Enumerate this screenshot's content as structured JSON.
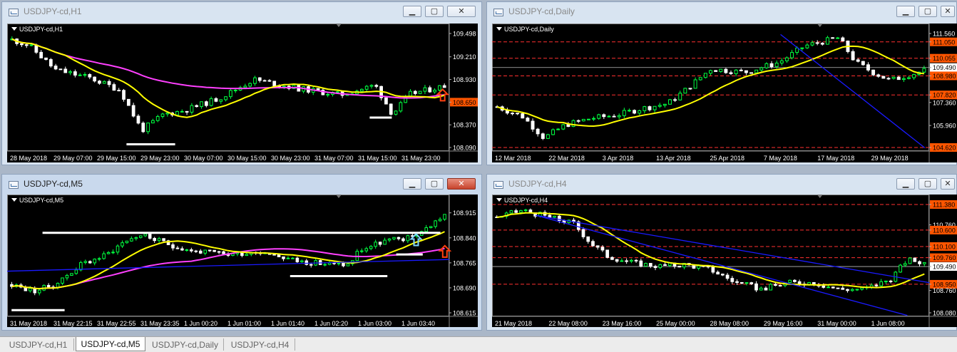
{
  "colors": {
    "bull": "#00ff40",
    "bear": "#ffffff",
    "ma": "#ffff00",
    "ma_slow": "#ff40ff",
    "level": "#ff3030",
    "trend": "#1a1aff",
    "label_bg": "#ff5500"
  },
  "icons": {
    "menu": "triangle-down-icon",
    "window": "chart-window-icon",
    "minimize": "minimize-icon",
    "restore": "restore-icon",
    "close": "close-icon"
  },
  "windows": {
    "h1": {
      "title": "USDJPY-cd,H1",
      "symbol": "USDJPY-cd,H1",
      "prices": [
        "109.498",
        "109.210",
        "108.930",
        "108.650",
        "108.370",
        "108.090"
      ],
      "current_price": "108.650",
      "times": [
        "28 May 2018",
        "29 May 07:00",
        "29 May 15:00",
        "29 May 23:00",
        "30 May 07:00",
        "30 May 15:00",
        "30 May 23:00",
        "31 May 07:00",
        "31 May 15:00",
        "31 May 23:00"
      ]
    },
    "daily": {
      "title": "USDJPY-cd,Daily",
      "symbol": "USDJPY-cd,Daily",
      "prices": [
        "111.560",
        "111.050",
        "110.055",
        "109.490",
        "108.980",
        "107.820",
        "107.360",
        "105.960",
        "104.620"
      ],
      "highlight_price": "109.490",
      "times": [
        "12 Mar 2018",
        "22 Mar 2018",
        "3 Apr 2018",
        "13 Apr 2018",
        "25 Apr 2018",
        "7 May 2018",
        "17 May 2018",
        "29 May 2018"
      ]
    },
    "m5": {
      "title": "USDJPY-cd,M5",
      "symbol": "USDJPY-cd,M5",
      "prices": [
        "108.915",
        "108.840",
        "108.765",
        "108.690",
        "108.615"
      ],
      "times": [
        "31 May 2018",
        "31 May 22:15",
        "31 May 22:55",
        "31 May 23:35",
        "1 Jun 00:20",
        "1 Jun 01:00",
        "1 Jun 01:40",
        "1 Jun 02:20",
        "1 Jun 03:00",
        "1 Jun 03:40"
      ]
    },
    "h4": {
      "title": "USDJPY-cd,H4",
      "symbol": "USDJPY-cd,H4",
      "prices": [
        "111.380",
        "110.760",
        "110.600",
        "110.100",
        "109.760",
        "109.490",
        "108.950",
        "108.760",
        "108.080"
      ],
      "highlight_price": "109.490",
      "times": [
        "21 May 2018",
        "22 May 08:00",
        "23 May 16:00",
        "25 May 00:00",
        "28 May 08:00",
        "29 May 16:00",
        "31 May 00:00",
        "1 Jun 08:00"
      ]
    }
  },
  "chart_data": [
    {
      "type": "candlestick",
      "name": "USDJPY-cd,H1",
      "x_labels": [
        "28 May 2018",
        "29 May 07:00",
        "29 May 15:00",
        "29 May 23:00",
        "30 May 07:00",
        "30 May 15:00",
        "30 May 23:00",
        "31 May 07:00",
        "31 May 15:00",
        "31 May 23:00"
      ],
      "ylim": [
        108.09,
        109.498
      ],
      "y_ticks": [
        109.498,
        109.21,
        108.93,
        108.65,
        108.37,
        108.09
      ],
      "anchors": [
        [
          0,
          109.42
        ],
        [
          0.04,
          109.35
        ],
        [
          0.1,
          109.05
        ],
        [
          0.18,
          108.95
        ],
        [
          0.25,
          108.8
        ],
        [
          0.3,
          108.3
        ],
        [
          0.35,
          108.5
        ],
        [
          0.4,
          108.55
        ],
        [
          0.48,
          108.7
        ],
        [
          0.56,
          108.93
        ],
        [
          0.66,
          108.82
        ],
        [
          0.76,
          108.74
        ],
        [
          0.84,
          108.86
        ],
        [
          0.88,
          108.5
        ],
        [
          0.92,
          108.75
        ],
        [
          1.0,
          108.85
        ]
      ]
    },
    {
      "type": "candlestick",
      "name": "USDJPY-cd,Daily",
      "x_labels": [
        "12 Mar 2018",
        "22 Mar 2018",
        "3 Apr 2018",
        "13 Apr 2018",
        "25 Apr 2018",
        "7 May 2018",
        "17 May 2018",
        "29 May 2018"
      ],
      "ylim": [
        104.62,
        111.56
      ],
      "levels": [
        111.05,
        110.055,
        108.98,
        107.82,
        104.62
      ],
      "anchors": [
        [
          0,
          107.1
        ],
        [
          0.06,
          106.5
        ],
        [
          0.11,
          105.2
        ],
        [
          0.16,
          106.0
        ],
        [
          0.22,
          106.4
        ],
        [
          0.28,
          106.6
        ],
        [
          0.34,
          107.0
        ],
        [
          0.4,
          107.3
        ],
        [
          0.44,
          108.1
        ],
        [
          0.5,
          109.4
        ],
        [
          0.58,
          109.2
        ],
        [
          0.66,
          109.8
        ],
        [
          0.72,
          110.8
        ],
        [
          0.8,
          111.3
        ],
        [
          0.84,
          109.8
        ],
        [
          0.88,
          109.2
        ],
        [
          0.92,
          108.7
        ],
        [
          0.96,
          109.0
        ],
        [
          1.0,
          109.3
        ]
      ]
    },
    {
      "type": "candlestick",
      "name": "USDJPY-cd,M5",
      "x_labels": [
        "31 May 2018",
        "31 May 22:15",
        "31 May 22:55",
        "31 May 23:35",
        "1 Jun 00:20",
        "1 Jun 01:00",
        "1 Jun 01:40",
        "1 Jun 02:20",
        "1 Jun 03:00",
        "1 Jun 03:40"
      ],
      "ylim": [
        108.615,
        108.94
      ],
      "anchors": [
        [
          0,
          108.7
        ],
        [
          0.05,
          108.68
        ],
        [
          0.1,
          108.7
        ],
        [
          0.16,
          108.76
        ],
        [
          0.22,
          108.79
        ],
        [
          0.26,
          108.83
        ],
        [
          0.3,
          108.85
        ],
        [
          0.36,
          108.82
        ],
        [
          0.42,
          108.8
        ],
        [
          0.5,
          108.79
        ],
        [
          0.58,
          108.8
        ],
        [
          0.66,
          108.77
        ],
        [
          0.74,
          108.76
        ],
        [
          0.78,
          108.76
        ],
        [
          0.8,
          108.8
        ],
        [
          0.86,
          108.83
        ],
        [
          0.92,
          108.84
        ],
        [
          0.96,
          108.87
        ],
        [
          1.0,
          108.91
        ]
      ]
    },
    {
      "type": "candlestick",
      "name": "USDJPY-cd,H4",
      "x_labels": [
        "21 May 2018",
        "22 May 08:00",
        "23 May 16:00",
        "25 May 00:00",
        "28 May 08:00",
        "29 May 16:00",
        "31 May 00:00",
        "1 Jun 08:00"
      ],
      "ylim": [
        108.08,
        111.38
      ],
      "levels": [
        111.38,
        110.6,
        110.1,
        109.76,
        108.95
      ],
      "anchors": [
        [
          0,
          111.0
        ],
        [
          0.06,
          111.2
        ],
        [
          0.12,
          111.0
        ],
        [
          0.18,
          110.8
        ],
        [
          0.22,
          110.2
        ],
        [
          0.26,
          109.8
        ],
        [
          0.32,
          109.6
        ],
        [
          0.38,
          109.5
        ],
        [
          0.44,
          109.55
        ],
        [
          0.5,
          109.4
        ],
        [
          0.56,
          109.0
        ],
        [
          0.62,
          108.8
        ],
        [
          0.68,
          109.0
        ],
        [
          0.74,
          109.0
        ],
        [
          0.8,
          108.8
        ],
        [
          0.86,
          108.8
        ],
        [
          0.92,
          109.1
        ],
        [
          0.96,
          109.7
        ],
        [
          1.0,
          109.6
        ]
      ]
    }
  ],
  "tabs": [
    "USDJPY-cd,H1",
    "USDJPY-cd,M5",
    "USDJPY-cd,Daily",
    "USDJPY-cd,H4"
  ]
}
